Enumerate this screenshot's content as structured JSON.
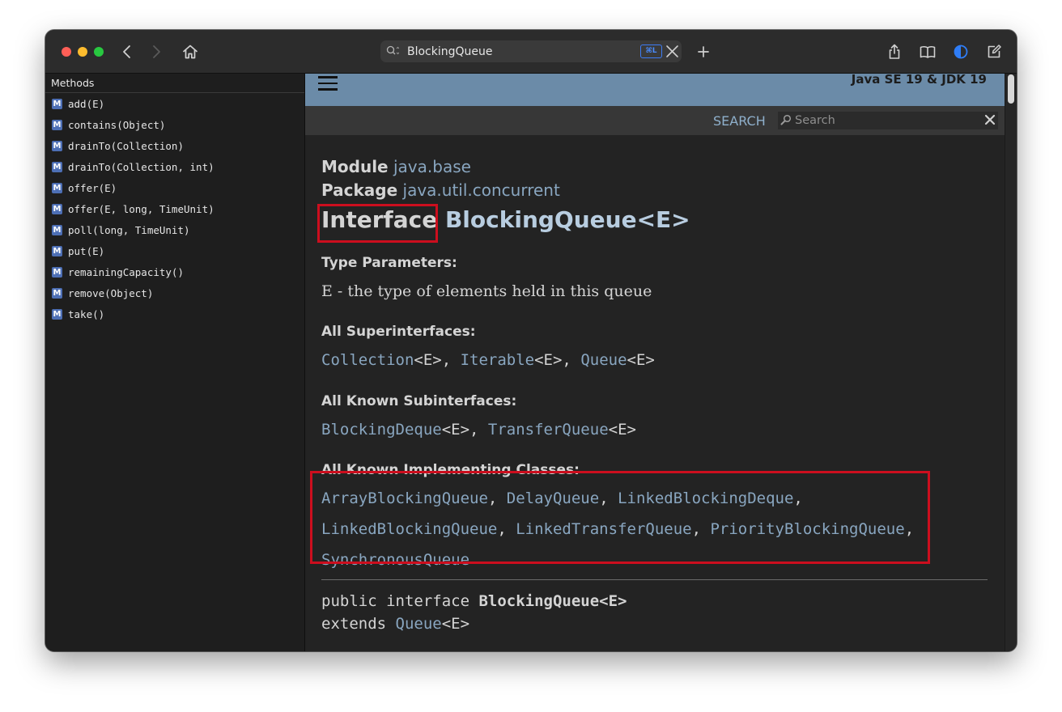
{
  "browser": {
    "url_text": "BlockingQueue",
    "shortcut_badge": "⌘L"
  },
  "sidebar": {
    "header": "Methods",
    "badge_letter": "M",
    "items": [
      {
        "label": "add(E)"
      },
      {
        "label": "contains(Object)"
      },
      {
        "label": "drainTo(Collection)"
      },
      {
        "label": "drainTo(Collection, int)"
      },
      {
        "label": "offer(E)"
      },
      {
        "label": "offer(E, long, TimeUnit)"
      },
      {
        "label": "poll(long, TimeUnit)"
      },
      {
        "label": "put(E)"
      },
      {
        "label": "remainingCapacity()"
      },
      {
        "label": "remove(Object)"
      },
      {
        "label": "take()"
      }
    ]
  },
  "doc": {
    "nav_title": "Java SE 19 & JDK 19",
    "search_label": "SEARCH",
    "search_placeholder": "Search",
    "module_label": "Module",
    "module_link": "java.base",
    "package_label": "Package",
    "package_link": "java.util.concurrent",
    "title_kind": "Interface",
    "title_name": "BlockingQueue<E>",
    "type_params_label": "Type Parameters:",
    "type_param_text": "E - the type of elements held in this queue",
    "superinterfaces_label": "All Superinterfaces:",
    "superinterfaces": {
      "s1": "Collection",
      "s1t": "<E>, ",
      "s2": "Iterable",
      "s2t": "<E>, ",
      "s3": "Queue",
      "s3t": "<E>"
    },
    "subinterfaces_label": "All Known Subinterfaces:",
    "subinterfaces": {
      "s1": "BlockingDeque",
      "s1t": "<E>, ",
      "s2": "TransferQueue",
      "s2t": "<E>"
    },
    "implementing_label": "All Known Implementing Classes:",
    "implementing": {
      "c1": "ArrayBlockingQueue",
      "c2": "DelayQueue",
      "c3": "LinkedBlockingDeque",
      "c4": "LinkedBlockingQueue",
      "c5": "LinkedTransferQueue",
      "c6": "PriorityBlockingQueue",
      "c7": "SynchronousQueue",
      "sep": ", ",
      "end": ","
    },
    "decl_prefix": "public interface ",
    "decl_name": "BlockingQueue<E>",
    "extends_kw": "extends ",
    "extends_link": "Queue",
    "extends_tail": "<E>"
  },
  "colors": {
    "nav_bar": "#6b8ba8",
    "link": "#89a6c0",
    "highlight_box": "#cc0e1e",
    "method_badge": "#4d6fb5"
  },
  "icons": [
    "back-chevron-icon",
    "forward-chevron-icon",
    "home-icon",
    "search-icon",
    "clear-icon",
    "new-tab-icon",
    "share-icon",
    "bookmarks-icon",
    "theme-toggle-icon",
    "edit-icon",
    "hamburger-menu-icon"
  ]
}
